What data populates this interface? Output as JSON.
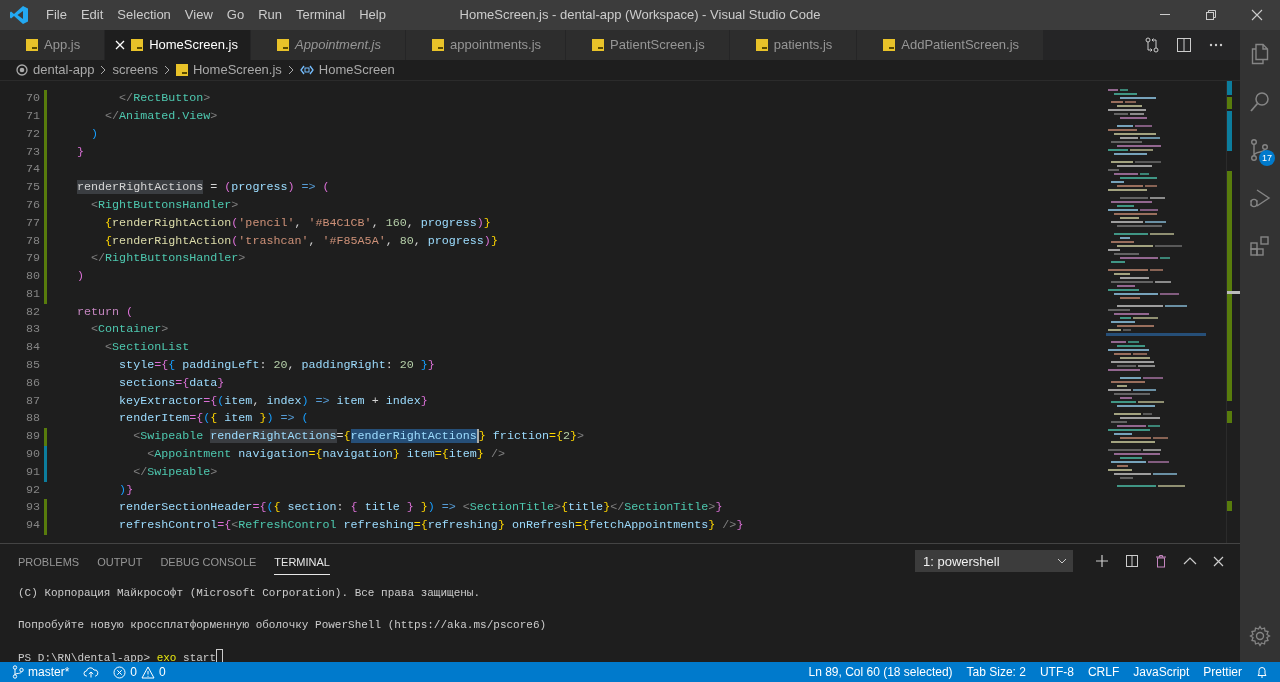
{
  "window": {
    "title": "HomeScreen.js - dental-app (Workspace) - Visual Studio Code"
  },
  "menu": [
    "File",
    "Edit",
    "Selection",
    "View",
    "Go",
    "Run",
    "Terminal",
    "Help"
  ],
  "tabs": [
    {
      "label": "App.js",
      "selected": false,
      "preview": false
    },
    {
      "label": "HomeScreen.js",
      "selected": true,
      "preview": false
    },
    {
      "label": "Appointment.js",
      "selected": false,
      "preview": true
    },
    {
      "label": "appointments.js",
      "selected": false,
      "preview": false
    },
    {
      "label": "PatientScreen.js",
      "selected": false,
      "preview": false
    },
    {
      "label": "patients.js",
      "selected": false,
      "preview": false
    },
    {
      "label": "AddPatientScreen.js",
      "selected": false,
      "preview": false
    }
  ],
  "breadcrumbs": [
    {
      "kind": "root",
      "text": "dental-app"
    },
    {
      "kind": "folder",
      "text": "screens"
    },
    {
      "kind": "js-file",
      "text": "HomeScreen.js"
    },
    {
      "kind": "symbol",
      "text": "HomeScreen"
    }
  ],
  "editor": {
    "lines": [
      {
        "number": "70",
        "color": "#587c0c",
        "tokens": [
          {
            "text": "        </",
            "kind": "br"
          },
          {
            "text": "RectButton",
            "kind": "tag"
          },
          {
            "text": ">",
            "kind": "br"
          }
        ]
      },
      {
        "number": "71",
        "color": "#587c0c",
        "tokens": [
          {
            "text": "      </",
            "kind": "br"
          },
          {
            "text": "Animated.View",
            "kind": "tag"
          },
          {
            "text": ">",
            "kind": "br"
          }
        ]
      },
      {
        "number": "72",
        "color": "#587c0c",
        "tokens": [
          {
            "text": "    )",
            "kind": "b3"
          }
        ]
      },
      {
        "number": "73",
        "color": "#587c0c",
        "tokens": [
          {
            "text": "  }",
            "kind": "b2"
          }
        ]
      },
      {
        "number": "74",
        "color": "#587c0c"
      },
      {
        "number": "75",
        "color": "#587c0c",
        "tokens": [
          {
            "text": "  renderRightActions",
            "kind": "plain",
            "highlighted": true
          },
          {
            "text": " = ",
            "kind": "plain"
          },
          {
            "text": "(",
            "kind": "b2"
          },
          {
            "text": "progress",
            "kind": "var"
          },
          {
            "text": ")",
            "kind": "b2"
          },
          {
            "text": " => ",
            "kind": "op"
          },
          {
            "text": "(",
            "kind": "b2"
          }
        ]
      },
      {
        "number": "76",
        "color": "#587c0c",
        "tokens": [
          {
            "text": "    <",
            "kind": "br"
          },
          {
            "text": "RightButtonsHandler",
            "kind": "tag"
          },
          {
            "text": ">",
            "kind": "br"
          }
        ]
      },
      {
        "number": "77",
        "color": "#587c0c",
        "tokens": [
          {
            "text": "      {",
            "kind": "b1"
          },
          {
            "text": "renderRightAction",
            "kind": "fn"
          },
          {
            "text": "(",
            "kind": "b2"
          },
          {
            "text": "'pencil'",
            "kind": "str"
          },
          {
            "text": ", ",
            "kind": "plain"
          },
          {
            "text": "'#B4C1CB'",
            "kind": "str"
          },
          {
            "text": ", ",
            "kind": "plain"
          },
          {
            "text": "160",
            "kind": "num"
          },
          {
            "text": ", ",
            "kind": "plain"
          },
          {
            "text": "progress",
            "kind": "var"
          },
          {
            "text": ")",
            "kind": "b2"
          },
          {
            "text": "}",
            "kind": "b1"
          }
        ]
      },
      {
        "number": "78",
        "color": "#587c0c",
        "tokens": [
          {
            "text": "      {",
            "kind": "b1"
          },
          {
            "text": "renderRightAction",
            "kind": "fn"
          },
          {
            "text": "(",
            "kind": "b2"
          },
          {
            "text": "'trashcan'",
            "kind": "str"
          },
          {
            "text": ", ",
            "kind": "plain"
          },
          {
            "text": "'#F85A5A'",
            "kind": "str"
          },
          {
            "text": ", ",
            "kind": "plain"
          },
          {
            "text": "80",
            "kind": "num"
          },
          {
            "text": ", ",
            "kind": "plain"
          },
          {
            "text": "progress",
            "kind": "var"
          },
          {
            "text": ")",
            "kind": "b2"
          },
          {
            "text": "}",
            "kind": "b1"
          }
        ]
      },
      {
        "number": "79",
        "color": "#587c0c",
        "tokens": [
          {
            "text": "    </",
            "kind": "br"
          },
          {
            "text": "RightButtonsHandler",
            "kind": "tag"
          },
          {
            "text": ">",
            "kind": "br"
          }
        ]
      },
      {
        "number": "80",
        "color": "#587c0c",
        "tokens": [
          {
            "text": "  )",
            "kind": "b2"
          }
        ]
      },
      {
        "number": "81",
        "color": "#587c0c"
      },
      {
        "number": "82",
        "tokens": [
          {
            "text": "  return",
            "kind": "kw"
          },
          {
            "text": " (",
            "kind": "b2"
          }
        ]
      },
      {
        "number": "83",
        "tokens": [
          {
            "text": "    <",
            "kind": "br"
          },
          {
            "text": "Container",
            "kind": "tag"
          },
          {
            "text": ">",
            "kind": "br"
          }
        ]
      },
      {
        "number": "84",
        "tokens": [
          {
            "text": "      <",
            "kind": "br"
          },
          {
            "text": "SectionList",
            "kind": "tag"
          }
        ]
      },
      {
        "number": "85",
        "tokens": [
          {
            "text": "        style",
            "kind": "attr"
          },
          {
            "text": "={",
            "kind": "b2"
          },
          {
            "text": "{ ",
            "kind": "b3"
          },
          {
            "text": "paddingLeft",
            "kind": "var"
          },
          {
            "text": ": ",
            "kind": "plain"
          },
          {
            "text": "20",
            "kind": "num"
          },
          {
            "text": ", ",
            "kind": "plain"
          },
          {
            "text": "paddingRight",
            "kind": "var"
          },
          {
            "text": ": ",
            "kind": "plain"
          },
          {
            "text": "20",
            "kind": "num"
          },
          {
            "text": " }",
            "kind": "b3"
          },
          {
            "text": "}",
            "kind": "b2"
          }
        ]
      },
      {
        "number": "86",
        "tokens": [
          {
            "text": "        sections",
            "kind": "attr"
          },
          {
            "text": "={",
            "kind": "b2"
          },
          {
            "text": "data",
            "kind": "var"
          },
          {
            "text": "}",
            "kind": "b2"
          }
        ]
      },
      {
        "number": "87",
        "tokens": [
          {
            "text": "        keyExtractor",
            "kind": "attr"
          },
          {
            "text": "={",
            "kind": "b2"
          },
          {
            "text": "(",
            "kind": "b3"
          },
          {
            "text": "item",
            "kind": "var"
          },
          {
            "text": ", ",
            "kind": "plain"
          },
          {
            "text": "index",
            "kind": "var"
          },
          {
            "text": ")",
            "kind": "b3"
          },
          {
            "text": " => ",
            "kind": "op"
          },
          {
            "text": "item",
            "kind": "var"
          },
          {
            "text": " + ",
            "kind": "plain"
          },
          {
            "text": "index",
            "kind": "var"
          },
          {
            "text": "}",
            "kind": "b2"
          }
        ]
      },
      {
        "number": "88",
        "tokens": [
          {
            "text": "        renderItem",
            "kind": "attr"
          },
          {
            "text": "={",
            "kind": "b2"
          },
          {
            "text": "(",
            "kind": "b3"
          },
          {
            "text": "{ ",
            "kind": "b1"
          },
          {
            "text": "item",
            "kind": "var"
          },
          {
            "text": " }",
            "kind": "b1"
          },
          {
            "text": ")",
            "kind": "b3"
          },
          {
            "text": " => ",
            "kind": "op"
          },
          {
            "text": "(",
            "kind": "b3"
          }
        ]
      },
      {
        "number": "89",
        "color": "#587c0c",
        "tokens": [
          {
            "text": "          <",
            "kind": "br"
          },
          {
            "text": "Swipeable",
            "kind": "tag"
          },
          {
            "text": " renderRightActions",
            "kind": "attr",
            "highlighted": true
          },
          {
            "text": "=",
            "kind": "plain"
          },
          {
            "text": "{",
            "kind": "b1"
          },
          {
            "text": "renderRightActions",
            "kind": "var",
            "selected": true
          },
          {
            "text": "}",
            "kind": "b1"
          },
          {
            "text": " friction",
            "kind": "attr"
          },
          {
            "text": "={",
            "kind": "b1"
          },
          {
            "text": "2",
            "kind": "num"
          },
          {
            "text": "}",
            "kind": "b1"
          },
          {
            "text": ">",
            "kind": "br"
          }
        ]
      },
      {
        "number": "90",
        "color": "#0c7d9d",
        "tokens": [
          {
            "text": "            <",
            "kind": "br"
          },
          {
            "text": "Appointment",
            "kind": "tag"
          },
          {
            "text": " navigation",
            "kind": "attr"
          },
          {
            "text": "={",
            "kind": "b1"
          },
          {
            "text": "navigation",
            "kind": "var"
          },
          {
            "text": "}",
            "kind": "b1"
          },
          {
            "text": " item",
            "kind": "attr"
          },
          {
            "text": "={",
            "kind": "b1"
          },
          {
            "text": "item",
            "kind": "var"
          },
          {
            "text": "}",
            "kind": "b1"
          },
          {
            "text": " />",
            "kind": "br"
          }
        ]
      },
      {
        "number": "91",
        "color": "#0c7d9d",
        "tokens": [
          {
            "text": "          </",
            "kind": "br"
          },
          {
            "text": "Swipeable",
            "kind": "tag"
          },
          {
            "text": ">",
            "kind": "br"
          }
        ]
      },
      {
        "number": "92",
        "tokens": [
          {
            "text": "        )",
            "kind": "b3"
          },
          {
            "text": "}",
            "kind": "b2"
          }
        ]
      },
      {
        "number": "93",
        "color": "#587c0c",
        "tokens": [
          {
            "text": "        renderSectionHeader",
            "kind": "attr"
          },
          {
            "text": "={",
            "kind": "b2"
          },
          {
            "text": "(",
            "kind": "b3"
          },
          {
            "text": "{ ",
            "kind": "b1"
          },
          {
            "text": "section",
            "kind": "var"
          },
          {
            "text": ": ",
            "kind": "plain"
          },
          {
            "text": "{ ",
            "kind": "b2"
          },
          {
            "text": "title",
            "kind": "var"
          },
          {
            "text": " }",
            "kind": "b2"
          },
          {
            "text": " }",
            "kind": "b1"
          },
          {
            "text": ")",
            "kind": "b3"
          },
          {
            "text": " => ",
            "kind": "op"
          },
          {
            "text": "<",
            "kind": "br"
          },
          {
            "text": "SectionTitle",
            "kind": "tag"
          },
          {
            "text": ">",
            "kind": "br"
          },
          {
            "text": "{",
            "kind": "b1"
          },
          {
            "text": "title",
            "kind": "var"
          },
          {
            "text": "}",
            "kind": "b1"
          },
          {
            "text": "</",
            "kind": "br"
          },
          {
            "text": "SectionTitle",
            "kind": "tag"
          },
          {
            "text": ">",
            "kind": "br"
          },
          {
            "text": "}",
            "kind": "b2"
          }
        ]
      },
      {
        "number": "94",
        "color": "#587c0c",
        "tokens": [
          {
            "text": "        refreshControl",
            "kind": "attr"
          },
          {
            "text": "={",
            "kind": "b2"
          },
          {
            "text": "<",
            "kind": "br"
          },
          {
            "text": "RefreshControl",
            "kind": "tag"
          },
          {
            "text": " refreshing",
            "kind": "attr"
          },
          {
            "text": "={",
            "kind": "b1"
          },
          {
            "text": "refreshing",
            "kind": "var"
          },
          {
            "text": "}",
            "kind": "b1"
          },
          {
            "text": " onRefresh",
            "kind": "attr"
          },
          {
            "text": "={",
            "kind": "b1"
          },
          {
            "text": "fetchAppointments",
            "kind": "var"
          },
          {
            "text": "}",
            "kind": "b1"
          },
          {
            "text": " />",
            "kind": "br"
          },
          {
            "text": "}",
            "kind": "b2"
          }
        ]
      }
    ]
  },
  "panel": {
    "tabs": [
      {
        "label": "PROBLEMS",
        "selected": false
      },
      {
        "label": "OUTPUT",
        "selected": false
      },
      {
        "label": "DEBUG CONSOLE",
        "selected": false
      },
      {
        "label": "TERMINAL",
        "selected": true
      }
    ],
    "terminal_select": "1: powershell",
    "terminal": [
      {
        "kind": "output",
        "text": "(C) Корпорация Майкрософт (Microsoft Corporation). Все права защищены."
      },
      {
        "kind": "output",
        "text": "Попробуйте новую кроссплатформенную оболочку PowerShell (https://aka.ms/pscore6)"
      },
      {
        "kind": "prompt",
        "prompt": "PS D:\\RN\\dental-app>",
        "command": "exo",
        "argument": "start",
        "cursor": true
      }
    ]
  },
  "activity_bar": {
    "source_control_badge": "17"
  },
  "status_bar": {
    "branch": "master*",
    "errors": "0",
    "warnings": "0",
    "right": [
      "Ln 89, Col 60 (18 selected)",
      "Tab Size: 2",
      "UTF-8",
      "CRLF",
      "JavaScript",
      "Prettier"
    ]
  }
}
